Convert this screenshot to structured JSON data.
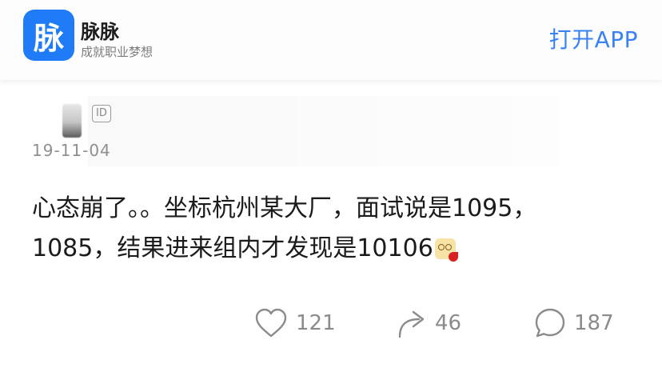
{
  "header": {
    "app_icon_char": "脉",
    "app_name": "脉脉",
    "slogan": "成就职业梦想",
    "open_app_label": "打开APP"
  },
  "post": {
    "id_badge": "ID",
    "date": "19-11-04",
    "line1": "心态崩了。。坐标杭州某大厂，面试说是1095，",
    "line2": "1085，结果进来组内才发现是10106"
  },
  "actions": {
    "like_count": "121",
    "share_count": "46",
    "comment_count": "187"
  },
  "colors": {
    "brand": "#1f7cf6",
    "link": "#3a82f4"
  }
}
